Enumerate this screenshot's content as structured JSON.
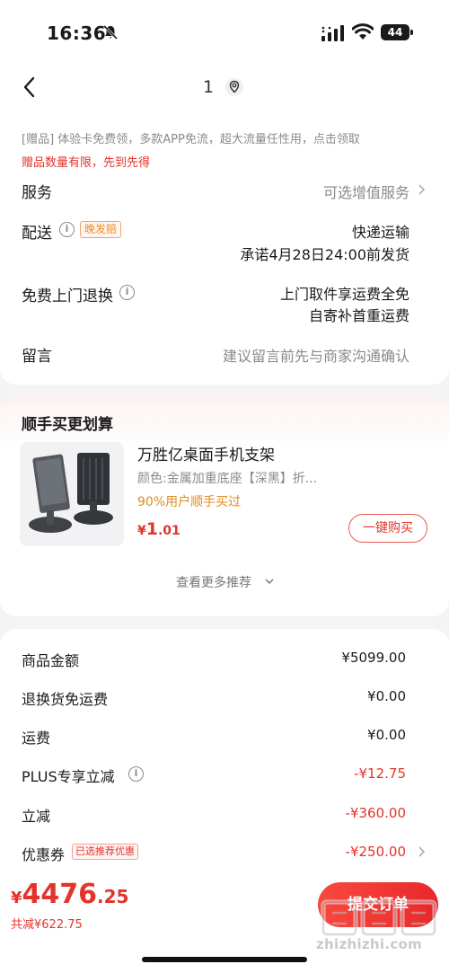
{
  "status_bar": {
    "time": "16:36",
    "battery": "44"
  },
  "nav": {
    "title": "1"
  },
  "gift": {
    "text": "[赠品] 体验卡免费领，多款APP免流，超大流量任性用，点击领取",
    "limit": "赠品数量有限，先到先得"
  },
  "service": {
    "label": "服务",
    "value": "可选增值服务"
  },
  "delivery": {
    "label": "配送",
    "tag": "晚发赔",
    "method": "快递运输",
    "promise": "承诺4月28日24:00前发货"
  },
  "pickup": {
    "label": "免费上门退换",
    "line1": "上门取件享运费全免",
    "line2": "自寄补首重运费"
  },
  "message": {
    "label": "留言",
    "placeholder": "建议留言前先与商家沟通确认"
  },
  "recommend": {
    "title": "顺手买更划算",
    "product_name": "万胜亿桌面手机支架",
    "spec": "颜色:金属加重底座【深黑】折...",
    "stat": "90%用户顺手买过",
    "price_symbol": "¥",
    "price_int": "1",
    "price_dec": ".01",
    "buy_label": "一键购买",
    "more_label": "查看更多推荐"
  },
  "summary": {
    "rows": [
      {
        "label": "商品金额",
        "value": "¥5099.00"
      },
      {
        "label": "退换货免运费",
        "value": "¥0.00"
      },
      {
        "label": "运费",
        "value": "¥0.00"
      },
      {
        "label": "PLUS专享立减",
        "value": "-¥12.75"
      },
      {
        "label": "立减",
        "value": "-¥360.00"
      },
      {
        "label": "优惠券",
        "tag": "已选推荐优惠",
        "value": "-¥250.00"
      }
    ]
  },
  "footer": {
    "price_symbol": "¥",
    "price_int": "4476",
    "price_dec": ".25",
    "saved": "共减¥622.75",
    "submit_label": "提交订单"
  },
  "watermark": {
    "text": "zhizhizhi.com"
  },
  "colors": {
    "accent_red": "#e4332a",
    "accent_orange": "#f08a24",
    "background": "#f4f4f6"
  }
}
